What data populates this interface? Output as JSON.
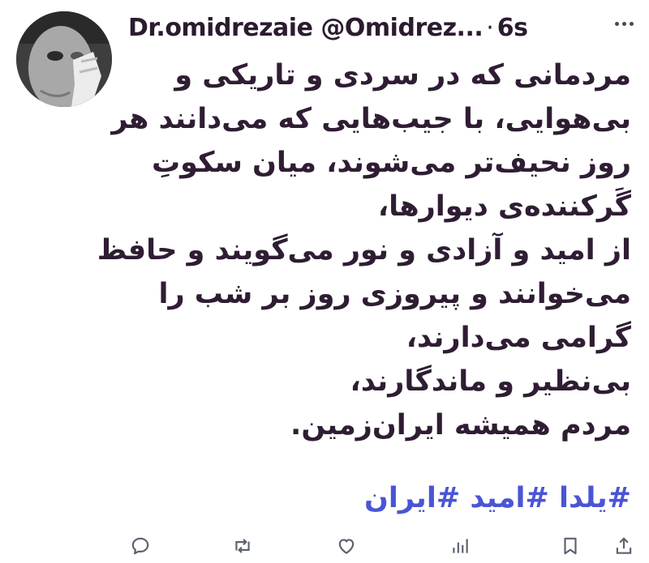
{
  "author": {
    "display_name": "Dr.omidrezaie",
    "handle": "@Omidrez...",
    "separator": "·",
    "time": "6s",
    "avatar_icon": "profile-photo-icon"
  },
  "tweet": {
    "lines": [
      "مردمانی که در سردی و تاریکی و",
      "بی‌هوایی، با جیب‌هایی که می‌دانند هر",
      "روز نحیف‌تر می‌شوند، میان سکوتِ",
      "گَرکننده‌ی دیوارها،",
      "از امید و آزادی و نور می‌گویند و حافظ",
      "می‌خوانند و پیروزی روز بر شب را",
      "گرامی می‌دارند،",
      "بی‌نظیر و ماندگارند،",
      "مردم همیشه ایران‌زمین."
    ],
    "hashtags": [
      "#یلدا",
      "#امید",
      "#ایران"
    ]
  },
  "actions": {
    "reply_icon": "reply-icon",
    "retweet_icon": "retweet-icon",
    "like_icon": "heart-icon",
    "views_icon": "views-icon",
    "bookmark_icon": "bookmark-icon",
    "share_icon": "share-icon"
  },
  "colors": {
    "text": "#2f1d33",
    "hashtag": "#4a55d6",
    "icon": "#5b6270"
  }
}
